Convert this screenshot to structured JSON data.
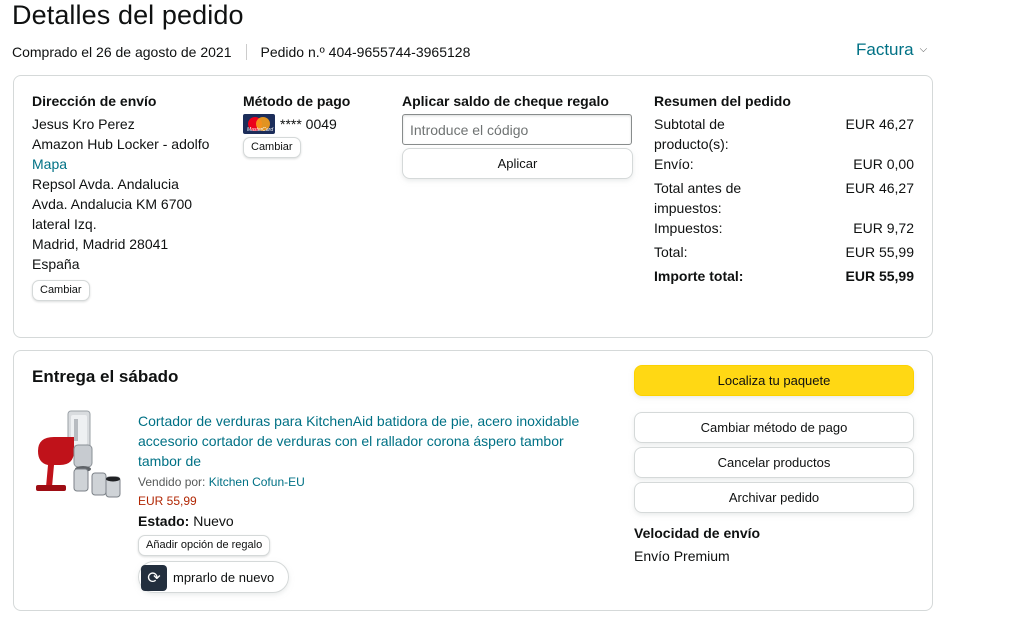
{
  "header": {
    "title": "Detalles del pedido",
    "purchased": "Comprado el 26 de agosto de 2021",
    "order_number": "Pedido n.º 404-9655744-3965128",
    "invoice_label": "Factura"
  },
  "shipping": {
    "heading": "Dirección de envío",
    "name": "Jesus Kro Perez",
    "line1": "Amazon Hub Locker - adolfo",
    "map_link": "Mapa",
    "line2": "Repsol Avda. Andalucia",
    "line3": "Avda. Andalucia KM 6700",
    "line4": "lateral Izq.",
    "line5": "Madrid, Madrid 28041",
    "country": "España",
    "change_label": "Cambiar"
  },
  "payment": {
    "heading": "Método de pago",
    "card_mask": "**** 0049",
    "card_icon": "mastercard-icon",
    "change_label": "Cambiar"
  },
  "gift": {
    "heading": "Aplicar saldo de cheque regalo",
    "placeholder": "Introduce el código",
    "apply_label": "Aplicar"
  },
  "summary": {
    "heading": "Resumen del pedido",
    "rows": [
      {
        "label": "Subtotal de producto(s):",
        "value": "EUR 46,27"
      },
      {
        "label": "Envío:",
        "value": "EUR 0,00"
      },
      {
        "label": "Total antes de impuestos:",
        "value": "EUR 46,27"
      },
      {
        "label": "Impuestos:",
        "value": "EUR 9,72"
      },
      {
        "label": "Total:",
        "value": "EUR 55,99"
      }
    ],
    "grand_label": "Importe total:",
    "grand_value": "EUR 55,99"
  },
  "delivery": {
    "title": "Entrega el sábado",
    "product_title": "Cortador de verduras para KitchenAid batidora de pie, acero inoxidable accesorio cortador de verduras con el rallador corona áspero tambor tambor de",
    "sold_by_prefix": "Vendido por:",
    "seller": "Kitchen Cofun-EU",
    "price": "EUR 55,99",
    "status_label": "Estado:",
    "status_value": "Nuevo",
    "gift_option_label": "Añadir opción de regalo",
    "buy_again_label": "mprarlo de nuevo"
  },
  "actions": {
    "track": "Localiza tu paquete",
    "change_payment": "Cambiar método de pago",
    "cancel": "Cancelar productos",
    "archive": "Archivar pedido",
    "speed_title": "Velocidad de envío",
    "speed_value": "Envío Premium"
  },
  "colors": {
    "link": "#007185",
    "primary_button": "#ffd814",
    "price": "#b12704",
    "border": "#d5d9d9"
  }
}
